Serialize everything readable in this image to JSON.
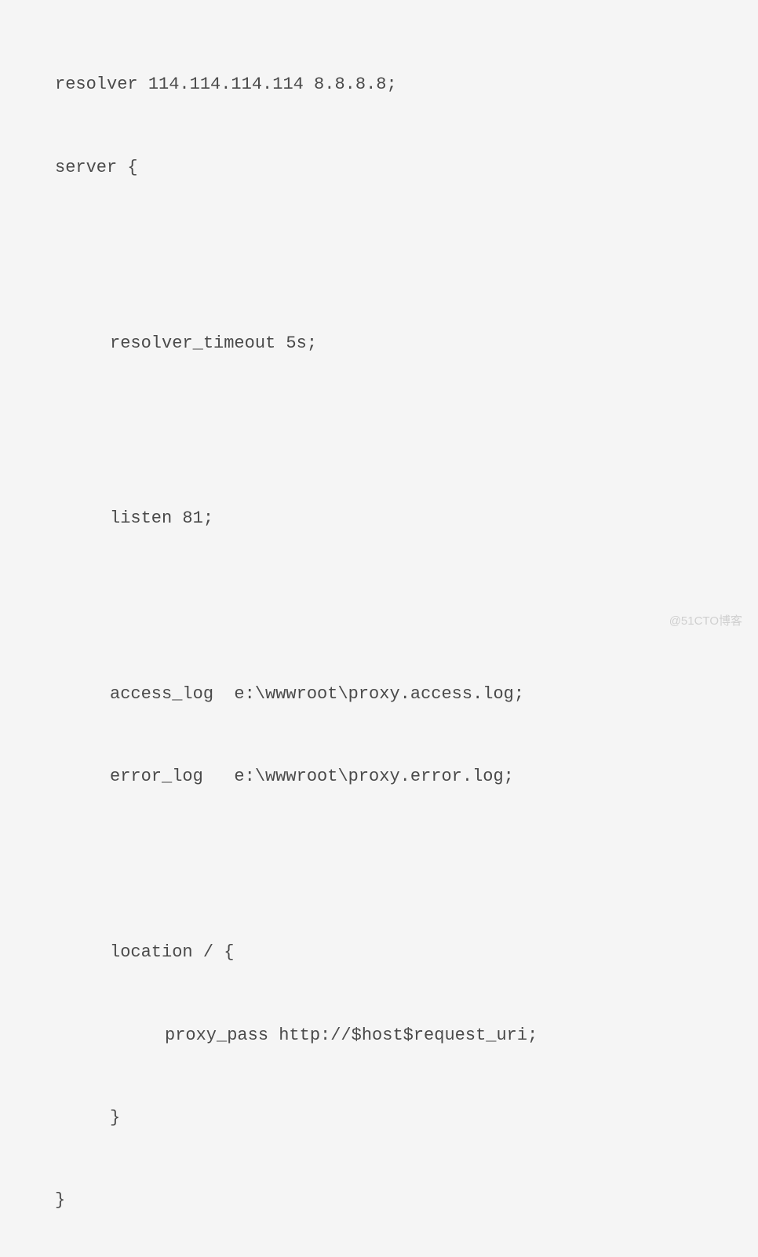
{
  "code": {
    "line1": "resolver 114.114.114.114 8.8.8.8;",
    "line2": "server {",
    "line3": "resolver_timeout 5s;",
    "line4": "listen 81;",
    "line5": "access_log  e:\\wwwroot\\proxy.access.log;",
    "line6": "error_log   e:\\wwwroot\\proxy.error.log;",
    "line7": "location / {",
    "line8": "proxy_pass http://$host$request_uri;",
    "line9": "}",
    "line10": "}"
  },
  "watermark": "@51CTO博客"
}
